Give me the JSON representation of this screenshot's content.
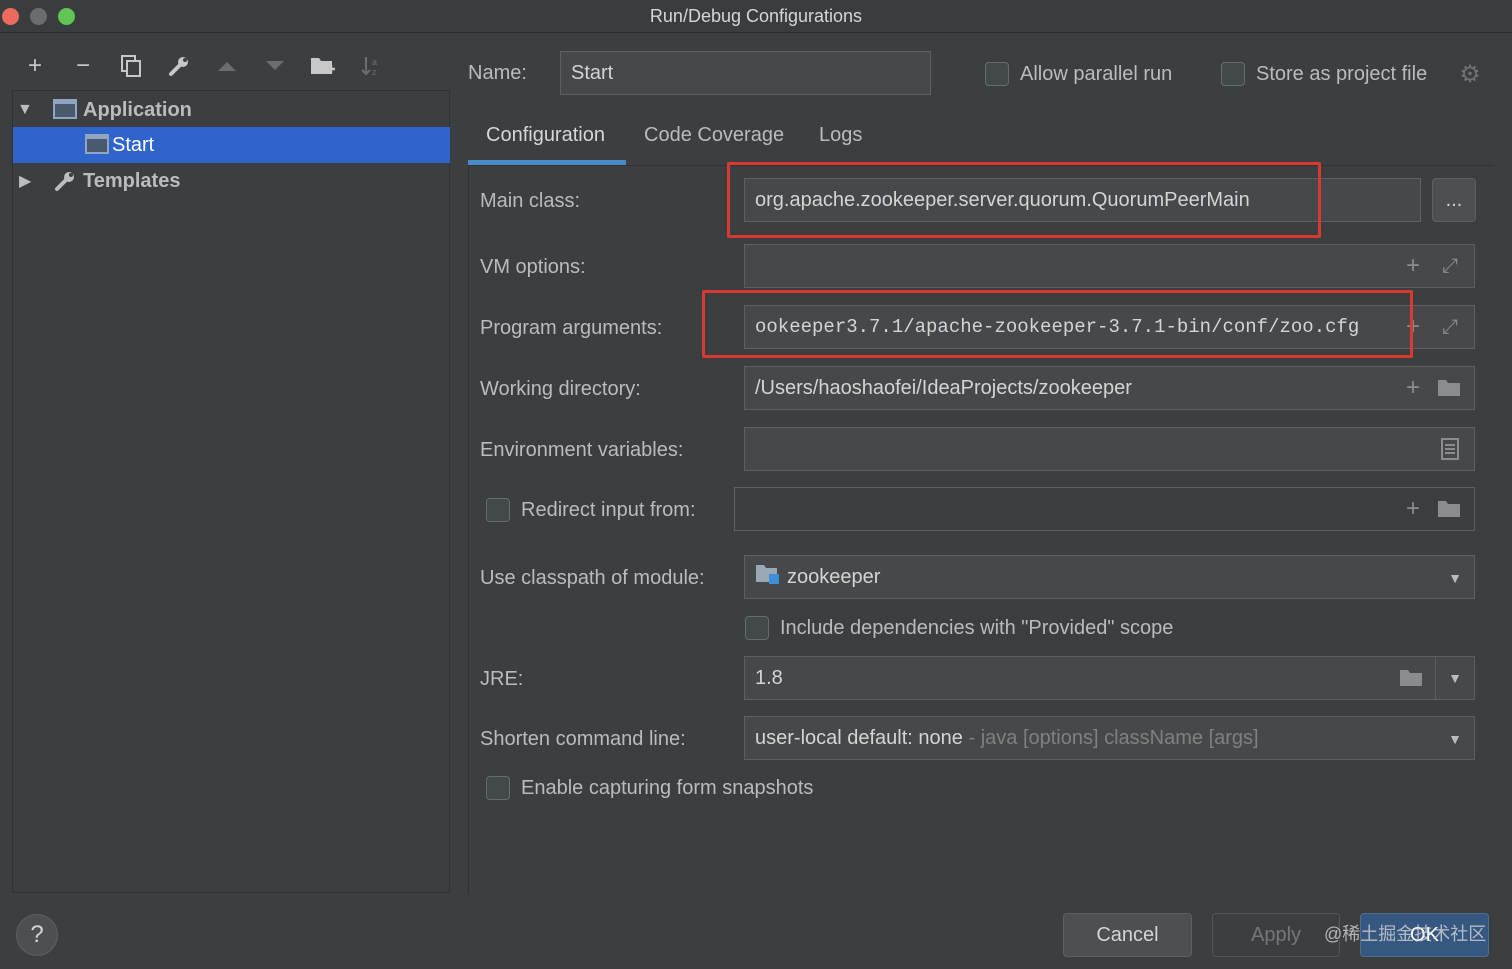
{
  "window": {
    "title": "Run/Debug Configurations"
  },
  "tree": {
    "application": "Application",
    "start": "Start",
    "templates": "Templates"
  },
  "name": {
    "label": "Name:",
    "value": "Start"
  },
  "options": {
    "allow_parallel": "Allow parallel run",
    "store_project": "Store as project file"
  },
  "tabs": [
    "Configuration",
    "Code Coverage",
    "Logs"
  ],
  "form": {
    "main_class": {
      "label": "Main class:",
      "value": "org.apache.zookeeper.server.quorum.QuorumPeerMain",
      "browse": "..."
    },
    "vm_options": {
      "label": "VM options:",
      "value": ""
    },
    "program_args": {
      "label": "Program arguments:",
      "value": "ookeeper3.7.1/apache-zookeeper-3.7.1-bin/conf/zoo.cfg"
    },
    "working_dir": {
      "label": "Working directory:",
      "value": "/Users/haoshaofei/IdeaProjects/zookeeper"
    },
    "env_vars": {
      "label": "Environment variables:",
      "value": ""
    },
    "redirect": {
      "label": "Redirect input from:",
      "value": ""
    },
    "classpath": {
      "label": "Use classpath of module:",
      "value": "zookeeper"
    },
    "include_deps": "Include dependencies with \"Provided\" scope",
    "jre": {
      "label": "JRE:",
      "value": "1.8"
    },
    "shorten": {
      "label": "Shorten command line:",
      "value": "user-local default: none",
      "hint": " - java [options] className [args]"
    },
    "snapshots": "Enable capturing form snapshots"
  },
  "buttons": {
    "cancel": "Cancel",
    "apply": "Apply",
    "ok": "OK",
    "help": "?"
  },
  "watermark": "@稀土掘金技术社区",
  "colors": {
    "selection": "#2f65ca",
    "highlight_box": "#d93a30",
    "tab_underline": "#4a88c7"
  }
}
